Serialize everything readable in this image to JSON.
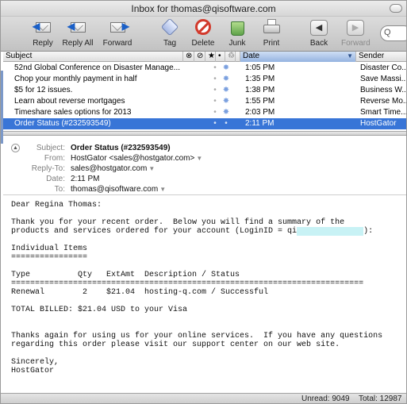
{
  "window": {
    "title": "Inbox for thomas@qisoftware.com"
  },
  "toolbar": {
    "reply": "Reply",
    "reply_all": "Reply All",
    "forward": "Forward",
    "tag": "Tag",
    "delete": "Delete",
    "junk": "Junk",
    "print": "Print",
    "back": "Back",
    "forward_nav": "Forward",
    "search_placeholder": "Q"
  },
  "columns": {
    "subject": "Subject",
    "date": "Date",
    "sender": "Sender"
  },
  "messages": [
    {
      "subject": "52nd Global Conference on Disaster Manage...",
      "date": "1:05 PM",
      "sender": "Disaster Co..."
    },
    {
      "subject": "Chop your monthly payment in half",
      "date": "1:35 PM",
      "sender": "Save Massi..."
    },
    {
      "subject": "$5 for 12 issues.",
      "date": "1:38 PM",
      "sender": "Business W..."
    },
    {
      "subject": "Learn about reverse mortgages",
      "date": "1:55 PM",
      "sender": "Reverse Mo..."
    },
    {
      "subject": "Timeshare sales options for 2013",
      "date": "2:03 PM",
      "sender": "Smart Time..."
    },
    {
      "subject": "Order Status (#232593549)",
      "date": "2:11 PM",
      "sender": "HostGator"
    }
  ],
  "header": {
    "subject_label": "Subject:",
    "subject": "Order Status (#232593549)",
    "from_label": "From:",
    "from": "HostGator <sales@hostgator.com>",
    "replyto_label": "Reply-To:",
    "replyto": "sales@hostgator.com",
    "date_label": "Date:",
    "date": "2:11 PM",
    "to_label": "To:",
    "to": "thomas@qisoftware.com"
  },
  "body": {
    "greeting": "Dear Regina Thomas:",
    "intro_line1": "Thank you for your recent order.  Below you will find a summary of the",
    "intro_line2a": "products and services ordered for your account (LoginID = qi",
    "intro_line2b": "):",
    "items_title": "Individual Items",
    "items_underline": "================",
    "table_header": "Type          Qty   ExtAmt  Description / Status",
    "table_rule": "==========================================================================",
    "table_row": "Renewal        2    $21.04  hosting-q.com / Successful",
    "total": "TOTAL BILLED: $21.04 USD to your Visa",
    "thanks_line1": "Thanks again for using us for your online services.  If you have any questions",
    "thanks_line2": "regarding this order please visit our support center on our web site.",
    "sign1": "Sincerely,",
    "sign2": "HostGator"
  },
  "status": {
    "unread": "Unread: 9049",
    "total": "Total: 12987"
  }
}
